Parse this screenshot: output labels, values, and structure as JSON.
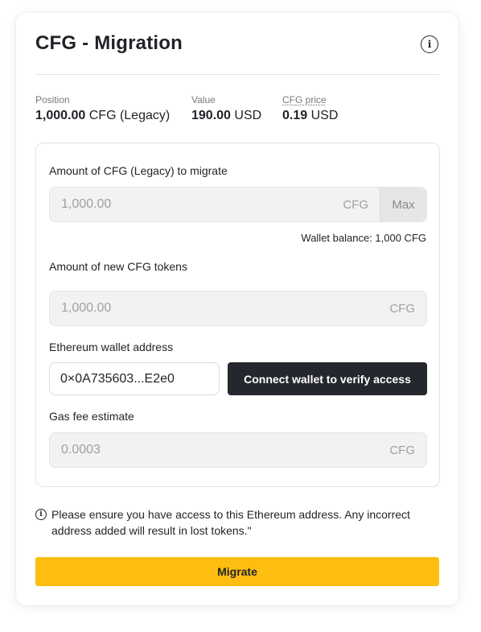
{
  "header": {
    "title": "CFG - Migration",
    "info_icon": "info-icon"
  },
  "stats": {
    "position": {
      "label": "Position",
      "amount": "1,000.00",
      "unit": "CFG (Legacy)"
    },
    "value": {
      "label": "Value",
      "amount": "190.00",
      "unit": "USD"
    },
    "price": {
      "label": "CFG price",
      "amount": "0.19",
      "unit": "USD"
    }
  },
  "form": {
    "legacy_amount": {
      "label": "Amount of CFG (Legacy) to migrate",
      "value": "1,000.00",
      "unit": "CFG",
      "max_label": "Max"
    },
    "wallet_balance": "Wallet balance: 1,000 CFG",
    "new_amount": {
      "label": "Amount of new CFG tokens",
      "value": "1,000.00",
      "unit": "CFG"
    },
    "eth_address": {
      "label": "Ethereum wallet address",
      "value": "0×0A735603...E2e0"
    },
    "connect_label": "Connect wallet to verify access",
    "gas_fee": {
      "label": "Gas fee estimate",
      "value": "0.0003",
      "unit": "CFG"
    }
  },
  "notice": {
    "icon": "info-icon",
    "text": "Please ensure you have access to this Ethereum address. Any incorrect address added will result in lost tokens.\""
  },
  "migrate_label": "Migrate",
  "colors": {
    "accent": "#fdbd11",
    "dark_button": "#24272e",
    "text": "#1f2227",
    "muted": "#7a7a7a"
  }
}
